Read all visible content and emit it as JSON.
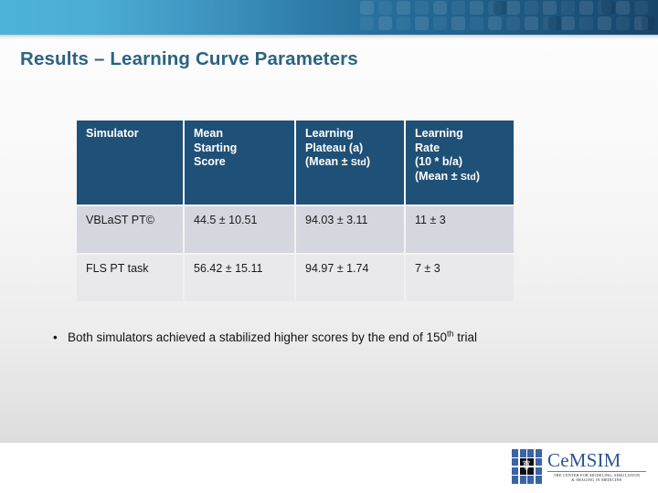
{
  "slide": {
    "title": "Results – Learning Curve Parameters",
    "title_color": "#2b6481"
  },
  "banner": {
    "gradient_from": "#4fb3d9",
    "gradient_to": "#17456a"
  },
  "table": {
    "header_bg": "#1f5077",
    "headers": [
      {
        "line1": "Simulator",
        "line2": "",
        "line3": "",
        "line4": ""
      },
      {
        "line1": "Mean",
        "line2": "Starting",
        "line3": "Score",
        "line4": ""
      },
      {
        "line1": "Learning",
        "line2": "Plateau (a)",
        "line3": "(Mean ± ",
        "line3_small": "Std",
        "line3_end": ")",
        "line4": ""
      },
      {
        "line1": "Learning",
        "line2": "Rate",
        "line3": "(10 * b/a)",
        "line4": "(Mean ± ",
        "line4_small": "Std",
        "line4_end": ")"
      }
    ],
    "rows": [
      {
        "simulator": "VBLaST PT©",
        "mean_starting_score": "44.5 ± 10.51",
        "learning_plateau": "94.03 ± 3.11",
        "learning_rate": "11 ± 3"
      },
      {
        "simulator": "FLS PT task",
        "mean_starting_score": "56.42 ± 15.11",
        "learning_plateau": "94.97 ± 1.74",
        "learning_rate": "7 ± 3"
      }
    ]
  },
  "bullet": {
    "marker": "•",
    "text_before": "Both simulators achieved a stabilized higher scores by the end of 150",
    "superscript": "th",
    "text_after": " trial"
  },
  "logo": {
    "name": "CeMSIM",
    "tagline_line1": "THE CENTER FOR MODELING, SIMULATION",
    "tagline_line2": "& IMAGING IN MEDICINE",
    "square_color": "#3a63a8"
  }
}
